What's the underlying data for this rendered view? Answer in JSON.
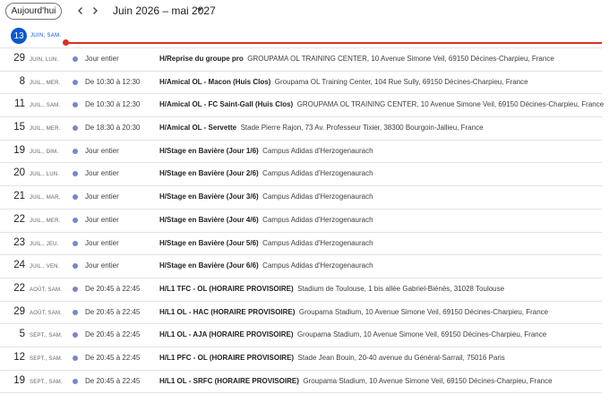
{
  "toolbar": {
    "today_label": "Aujourd'hui",
    "date_range": "Juin 2026 – mai 2027",
    "icons": {
      "prev": "chevron-left-icon",
      "next": "chevron-right-icon",
      "dropdown": "caret-down-icon"
    }
  },
  "today": {
    "day": "13",
    "meta": "JUIN, SAM."
  },
  "colors": {
    "accent": "#0b57d0",
    "now_line": "#d93025",
    "event_dot": "#7986cb"
  },
  "events": [
    {
      "day": "29",
      "meta": "JUIN, LUN.",
      "time": "Jour entier",
      "title": "H/Reprise du groupe pro",
      "location": "GROUPAMA OL TRAINING CENTER, 10 Avenue Simone Veil, 69150 Décines-Charpieu, France"
    },
    {
      "day": "8",
      "meta": "JUIL., MER.",
      "time": "De 10:30 à 12:30",
      "title": "H/Amical OL - Macon (Huis Clos)",
      "location": "Groupama OL Training Center, 104 Rue Sully, 69150 Décines-Charpieu, France"
    },
    {
      "day": "11",
      "meta": "JUIL., SAM.",
      "time": "De 10:30 à 12:30",
      "title": "H/Amical OL - FC Saint-Gall (Huis Clos)",
      "location": "GROUPAMA OL TRAINING CENTER, 10 Avenue Simone Veil, 69150 Décines-Charpieu, France"
    },
    {
      "day": "15",
      "meta": "JUIL., MER.",
      "time": "De 18:30 à 20:30",
      "title": "H/Amical OL - Servette",
      "location": "Stade Pierre Rajon, 73 Av. Professeur Tixier, 38300 Bourgoin-Jallieu, France"
    },
    {
      "day": "19",
      "meta": "JUIL., DIM.",
      "time": "Jour entier",
      "title": "H/Stage en Bavière (Jour 1/6)",
      "location": "Campus Adidas d'Herzogenaurach"
    },
    {
      "day": "20",
      "meta": "JUIL., LUN.",
      "time": "Jour entier",
      "title": "H/Stage en Bavière (Jour 2/6)",
      "location": "Campus Adidas d'Herzogenaurach"
    },
    {
      "day": "21",
      "meta": "JUIL., MAR.",
      "time": "Jour entier",
      "title": "H/Stage en Bavière (Jour 3/6)",
      "location": "Campus Adidas d'Herzogenaurach"
    },
    {
      "day": "22",
      "meta": "JUIL., MER.",
      "time": "Jour entier",
      "title": "H/Stage en Bavière (Jour 4/6)",
      "location": "Campus Adidas d'Herzogenaurach"
    },
    {
      "day": "23",
      "meta": "JUIL., JEU.",
      "time": "Jour entier",
      "title": "H/Stage en Bavière (Jour 5/6)",
      "location": "Campus Adidas d'Herzogenaurach"
    },
    {
      "day": "24",
      "meta": "JUIL., VEN.",
      "time": "Jour entier",
      "title": "H/Stage en Bavière (Jour 6/6)",
      "location": "Campus Adidas d'Herzogenaurach"
    },
    {
      "day": "22",
      "meta": "AOÛT, SAM.",
      "time": "De 20:45 à 22:45",
      "title": "H/L1 TFC - OL (HORAIRE PROVISOIRE)",
      "location": "Stadium de Toulouse, 1 bis allée Gabriel-Biénès, 31028 Toulouse"
    },
    {
      "day": "29",
      "meta": "AOÛT, SAM.",
      "time": "De 20:45 à 22:45",
      "title": "H/L1 OL - HAC (HORAIRE PROVISOIRE)",
      "location": "Groupama Stadium, 10 Avenue Simone Veil, 69150 Décines-Charpieu, France"
    },
    {
      "day": "5",
      "meta": "SEPT., SAM.",
      "time": "De 20:45 à 22:45",
      "title": "H/L1 OL - AJA (HORAIRE PROVISOIRE)",
      "location": "Groupama Stadium, 10 Avenue Simone Veil, 69150 Décines-Charpieu, France"
    },
    {
      "day": "12",
      "meta": "SEPT., SAM.",
      "time": "De 20:45 à 22:45",
      "title": "H/L1 PFC - OL (HORAIRE PROVISOIRE)",
      "location": "Stade Jean Bouin, 20-40 avenue du Général-Sarrail, 75016 Paris"
    },
    {
      "day": "19",
      "meta": "SEPT., SAM.",
      "time": "De 20:45 à 22:45",
      "title": "H/L1 OL - SRFC (HORAIRE PROVISOIRE)",
      "location": "Groupama Stadium, 10 Avenue Simone Veil, 69150 Décines-Charpieu, France"
    }
  ]
}
